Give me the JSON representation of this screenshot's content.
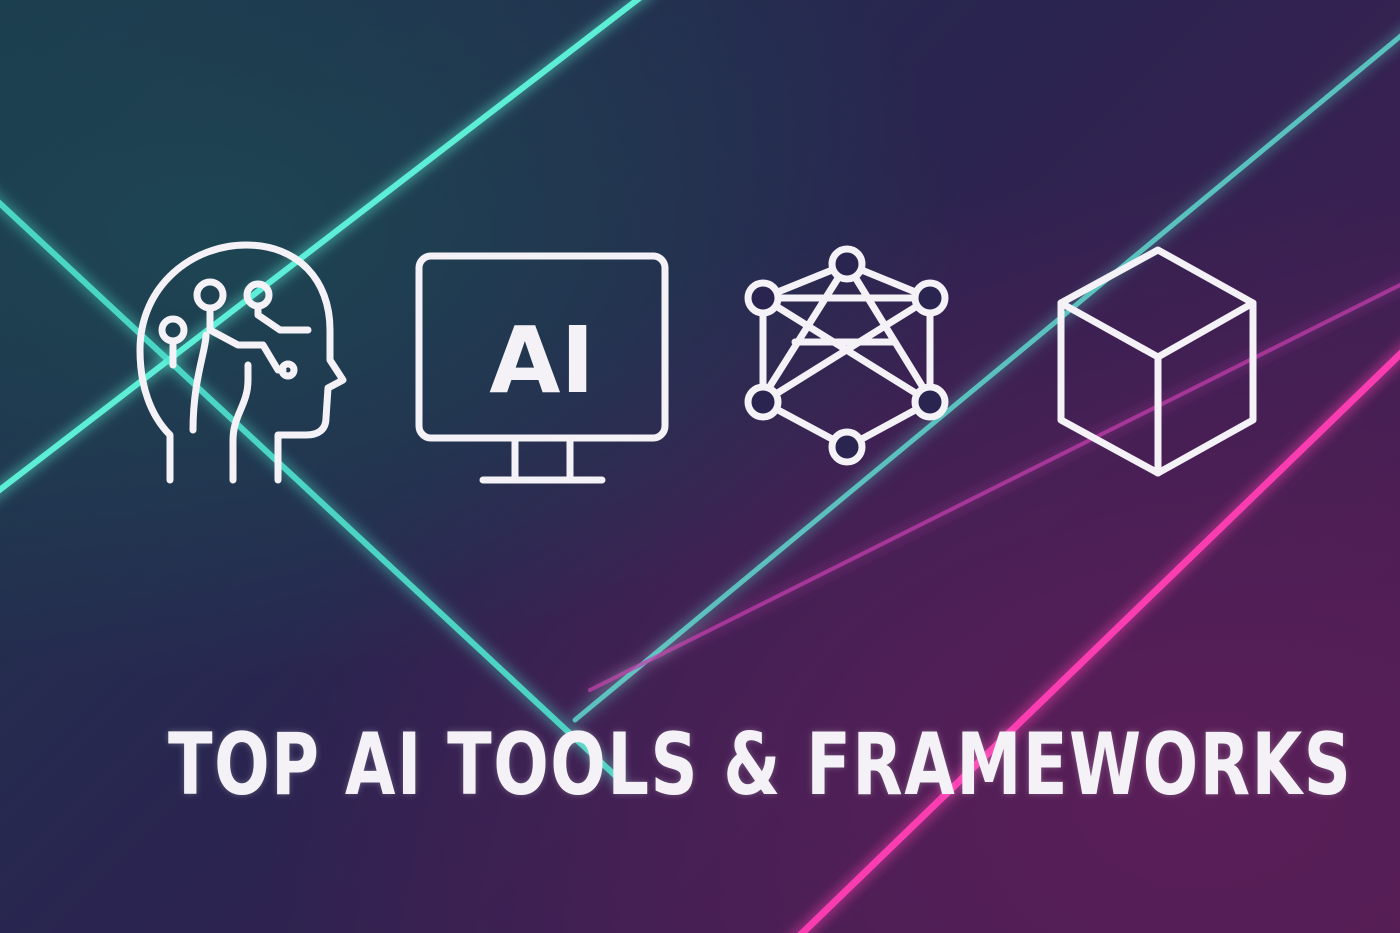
{
  "headline": "TOP AI TOOLS & FRAMEWORKS",
  "monitor_label": "AI",
  "icons": [
    "ai-head-icon",
    "ai-monitor-icon",
    "neural-network-icon",
    "cube-icon"
  ],
  "colors": {
    "background": "#2a2450",
    "cyan_beam": "#5ff5dc",
    "magenta_beam": "#ff3fb4",
    "icon_stroke": "#f4f2f7",
    "headline": "#f4f2f7"
  }
}
